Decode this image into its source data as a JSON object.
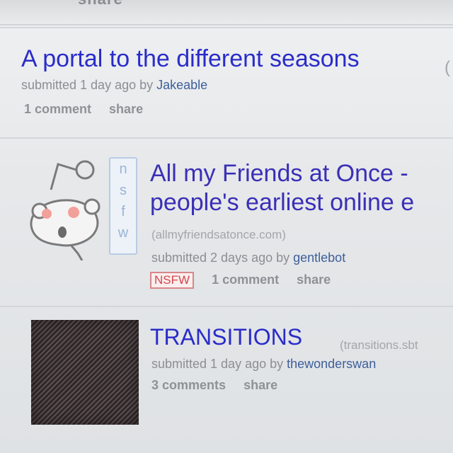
{
  "top": {
    "cut_text": "share"
  },
  "posts": [
    {
      "title": "A portal to the different seasons",
      "title_tail": "(",
      "submitted": "submitted 1 day ago by ",
      "author": "Jakeable",
      "comments": "1 comment",
      "share": "share"
    },
    {
      "thumb_letters": [
        "n",
        "s",
        "f",
        "w"
      ],
      "title_line1": "All my Friends at Once -",
      "title_line2": "people's earliest online e",
      "domain": "(allmyfriendsatonce.com)",
      "submitted": "submitted 2 days ago by ",
      "author": "gentlebot",
      "nsfw": "NSFW",
      "comments": "1 comment",
      "share": "share"
    },
    {
      "title": "TRANSITIONS",
      "domain": "(transitions.sbt",
      "submitted": "submitted 1 day ago by ",
      "author": "thewonderswan",
      "comments": "3 comments",
      "share": "share"
    }
  ],
  "colors": {
    "link": "#2a2cc9",
    "author": "#3e5f9a",
    "nsfw": "#d2474c"
  }
}
